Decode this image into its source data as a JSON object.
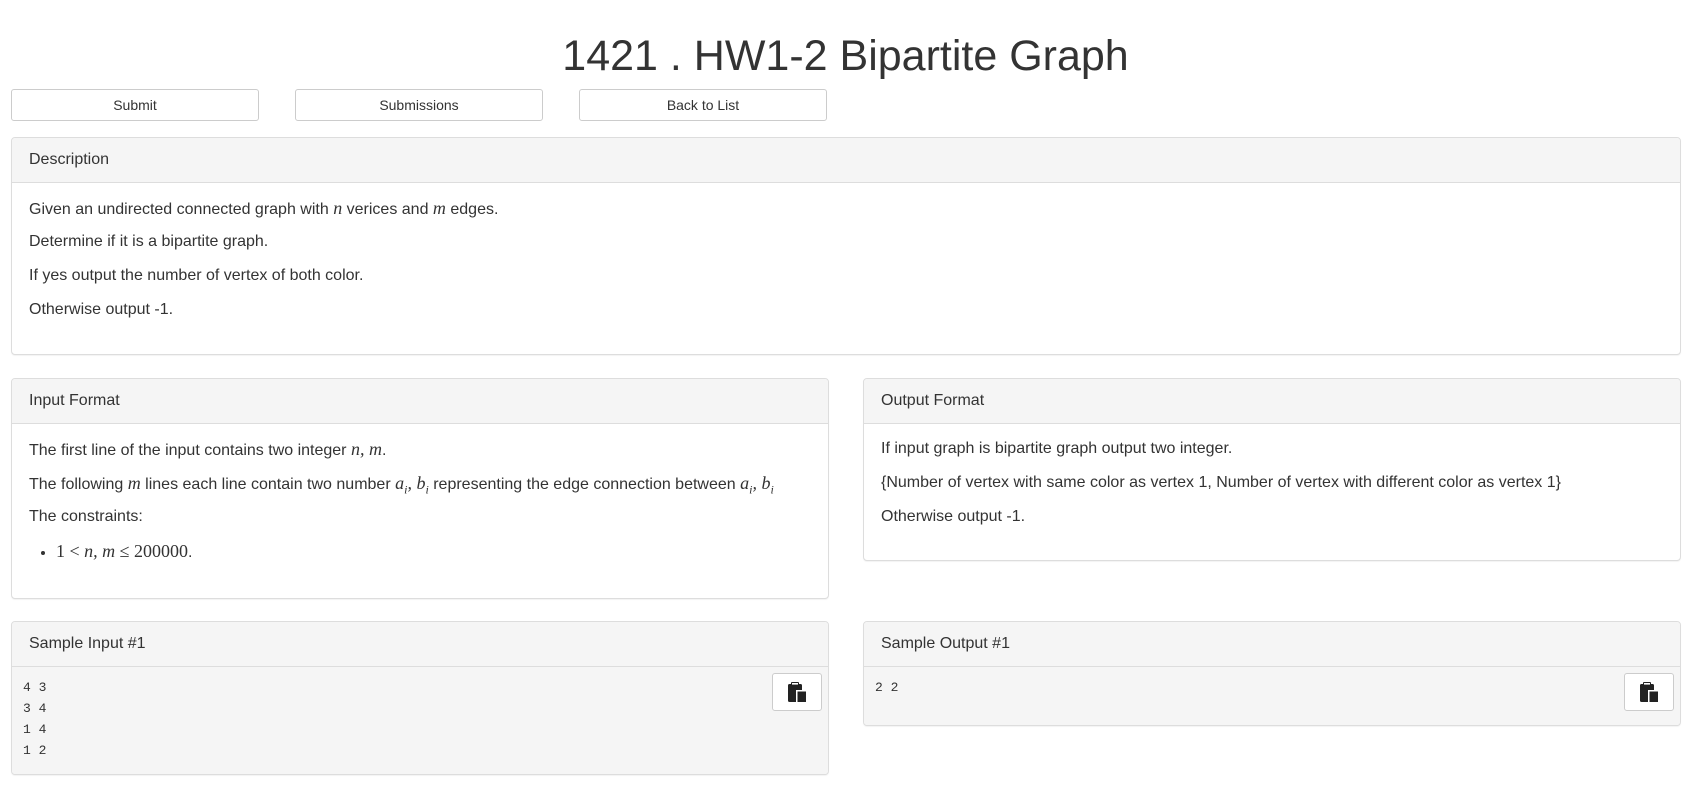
{
  "problem": {
    "title": "1421 . HW1-2 Bipartite Graph"
  },
  "toolbar": {
    "submit_label": "Submit",
    "submissions_label": "Submissions",
    "back_label": "Back to List"
  },
  "description": {
    "heading": "Description",
    "line1_pre": "Given an undirected connected graph with ",
    "line1_var_n": "n",
    "line1_mid": " verices and ",
    "line1_var_m": "m",
    "line1_post": " edges.",
    "line2": "Determine if it is a bipartite graph.",
    "line3": "If yes output the number of vertex of both color.",
    "line4": "Otherwise output -1."
  },
  "input_format": {
    "heading": "Input Format",
    "line1_pre": "The first line of the input contains two integer ",
    "line1_math": "n, m",
    "line1_post": ".",
    "line2_pre": "The following ",
    "line2_var_m": "m",
    "line2_mid": " lines each line contain two number ",
    "line2_math1": "a",
    "line2_sub1": "i",
    "line2_comma1": ", b",
    "line2_sub2": "i",
    "line2_mid2": " representing the edge connection between ",
    "line2_math2": "a",
    "line2_sub3": "i",
    "line2_comma2": ", b",
    "line2_sub4": "i",
    "line3": "The constraints:",
    "constraint_1": "1",
    "constraint_lt": " < ",
    "constraint_vars": "n, m",
    "constraint_le": " ≤ ",
    "constraint_num": "200000",
    "constraint_end": "."
  },
  "output_format": {
    "heading": "Output Format",
    "line1": "If input graph is bipartite graph output two integer.",
    "line2": "{Number of vertex with same color as vertex 1, Number of vertex with different color as vertex 1}",
    "line3": "Otherwise output -1."
  },
  "sample_input": {
    "heading": "Sample Input #1",
    "content": "4 3\n3 4\n1 4\n1 2",
    "copy_icon": "clipboard-icon"
  },
  "sample_output": {
    "heading": "Sample Output #1",
    "content": "2 2",
    "copy_icon": "clipboard-icon"
  }
}
